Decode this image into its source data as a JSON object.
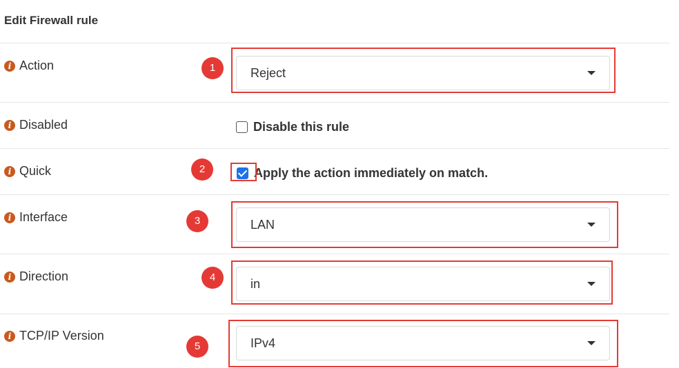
{
  "form": {
    "title": "Edit Firewall rule",
    "rows": [
      {
        "label": "Action",
        "type": "select",
        "value": "Reject",
        "callout": "1"
      },
      {
        "label": "Disabled",
        "type": "checkbox",
        "checkbox_label": "Disable this rule",
        "checked": false
      },
      {
        "label": "Quick",
        "type": "checkbox",
        "checkbox_label": "Apply the action immediately on match.",
        "checked": true,
        "callout": "2"
      },
      {
        "label": "Interface",
        "type": "select",
        "value": "LAN",
        "callout": "3"
      },
      {
        "label": "Direction",
        "type": "select",
        "value": "in",
        "callout": "4"
      },
      {
        "label": "TCP/IP Version",
        "type": "select",
        "value": "IPv4",
        "callout": "5"
      }
    ]
  },
  "icons": {
    "info": "info-icon",
    "dropdown": "chevron-down-icon"
  },
  "colors": {
    "callout": "#e53935",
    "info_icon": "#c85a1e",
    "checkbox_checked": "#1a73e8"
  }
}
